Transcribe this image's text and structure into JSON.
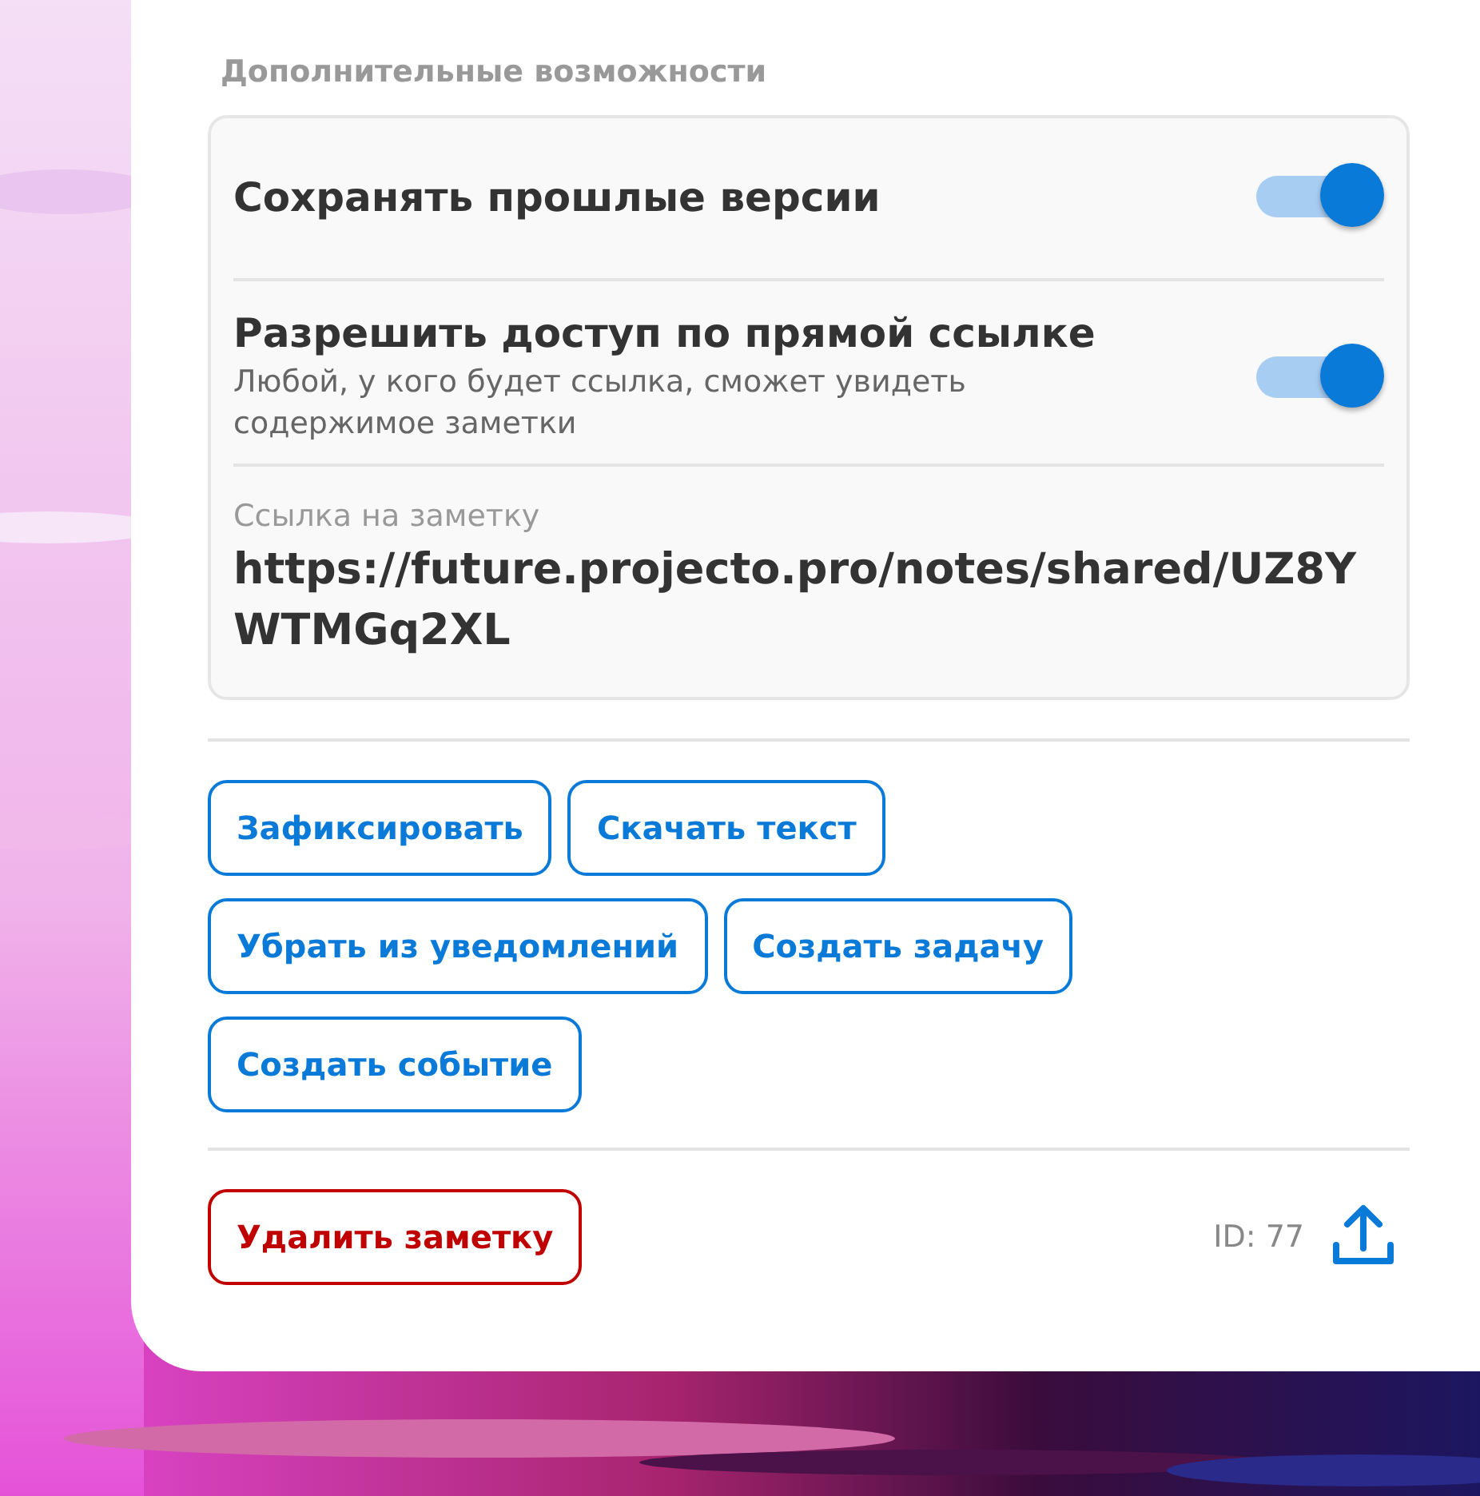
{
  "section_title": "Дополнительные возможности",
  "settings": [
    {
      "title": "Сохранять прошлые версии",
      "on": true
    },
    {
      "title": "Разрешить доступ по прямой ссылке",
      "description": "Любой, у кого будет ссылка, сможет увидеть содержимое заметки",
      "on": true
    }
  ],
  "link": {
    "label": "Ссылка на заметку",
    "value": "https://future.projecto.pro/notes/shared/UZ8YWTMGq2XL"
  },
  "actions": [
    {
      "label": "Зафиксировать"
    },
    {
      "label": "Скачать текст"
    },
    {
      "label": "Убрать из уведомлений"
    },
    {
      "label": "Создать задачу"
    },
    {
      "label": "Создать событие"
    }
  ],
  "footer": {
    "delete_label": "Удалить заметку",
    "id_text": "ID: 77"
  }
}
